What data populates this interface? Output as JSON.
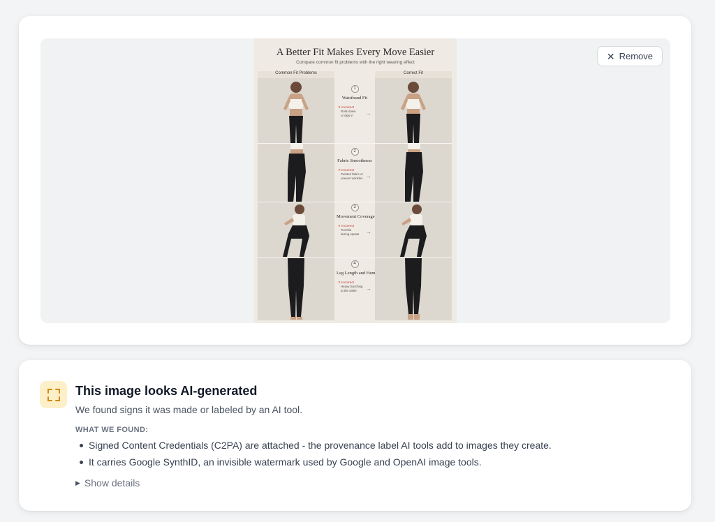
{
  "upload": {
    "remove_label": "Remove",
    "infographic": {
      "title": "A Better Fit Makes Every Move Easier",
      "subtitle": "Compare common fit problems with the right wearing effect",
      "left_header": "Common Fit Problems",
      "right_header": "Correct Fit",
      "steps": [
        {
          "num": "1",
          "title": "Waistband Fit",
          "incorrect": "Incorrect",
          "desc1": "Rolls down",
          "desc2": "or digs in"
        },
        {
          "num": "2",
          "title": "Fabric Smoothness",
          "incorrect": "Incorrect",
          "desc1": "Twisted fabric or",
          "desc2": "uneven wrinkles"
        },
        {
          "num": "3",
          "title": "Movement Coverage",
          "incorrect": "Incorrect",
          "desc1": "Too thin",
          "desc2": "during squats"
        },
        {
          "num": "4",
          "title": "Leg Length and Hem",
          "incorrect": "Incorrect",
          "desc1": "Heavy bunching",
          "desc2": "at the ankle"
        }
      ]
    }
  },
  "result": {
    "title": "This image looks AI-generated",
    "description": "We found signs it was made or labeled by an AI tool.",
    "found_label": "WHAT WE FOUND:",
    "findings": [
      "Signed Content Credentials (C2PA) are attached - the provenance label AI tools add to images they create.",
      "It carries Google SynthID, an invisible watermark used by Google and OpenAI image tools."
    ],
    "details_label": "Show details"
  },
  "colors": {
    "badge_bg": "#fdf0c8",
    "badge_icon": "#d08a12"
  }
}
